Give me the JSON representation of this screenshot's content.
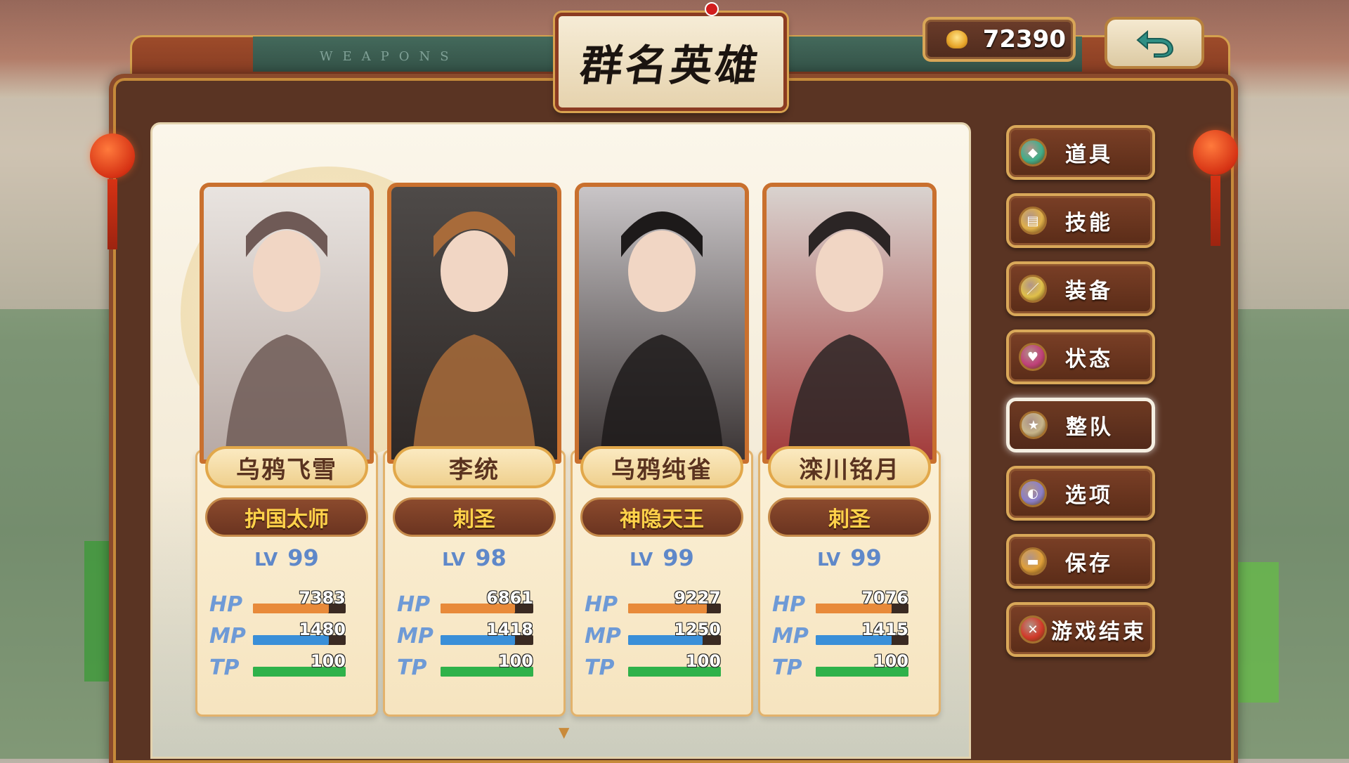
{
  "header": {
    "watermark": "WEAPONS",
    "title": "群名英雄",
    "gold_value": "72390",
    "gold_icon": "gold-ingot-icon",
    "back_icon": "return-arrow-icon"
  },
  "party": [
    {
      "name": "乌鸦飞雪",
      "title": "护国太师",
      "lv_label": "LV",
      "level": "99",
      "hp_label": "HP",
      "hp": "7383",
      "hp_fill": 0.82,
      "mp_label": "MP",
      "mp": "1480",
      "mp_fill": 0.82,
      "tp_label": "TP",
      "tp": "100",
      "tp_fill": 1.0
    },
    {
      "name": "李统",
      "title": "刺圣",
      "lv_label": "LV",
      "level": "98",
      "hp_label": "HP",
      "hp": "6861",
      "hp_fill": 0.8,
      "mp_label": "MP",
      "mp": "1418",
      "mp_fill": 0.8,
      "tp_label": "TP",
      "tp": "100",
      "tp_fill": 1.0
    },
    {
      "name": "乌鸦纯雀",
      "title": "神隐天王",
      "lv_label": "LV",
      "level": "99",
      "hp_label": "HP",
      "hp": "9227",
      "hp_fill": 0.85,
      "mp_label": "MP",
      "mp": "1250",
      "mp_fill": 0.8,
      "tp_label": "TP",
      "tp": "100",
      "tp_fill": 1.0
    },
    {
      "name": "滦川铭月",
      "title": "刺圣",
      "lv_label": "LV",
      "level": "99",
      "hp_label": "HP",
      "hp": "7076",
      "hp_fill": 0.82,
      "mp_label": "MP",
      "mp": "1415",
      "mp_fill": 0.82,
      "tp_label": "TP",
      "tp": "100",
      "tp_fill": 1.0
    }
  ],
  "menu": [
    {
      "label": "道具",
      "icon": "gem-icon",
      "color": "#3fae8a"
    },
    {
      "label": "技能",
      "icon": "scroll-icon",
      "color": "#e0b04a"
    },
    {
      "label": "装备",
      "icon": "sword-icon",
      "color": "#e0c04a"
    },
    {
      "label": "状态",
      "icon": "heart-icon",
      "color": "#c0407a"
    },
    {
      "label": "整队",
      "icon": "star-icon",
      "color": "#c7b58a",
      "active": true
    },
    {
      "label": "选项",
      "icon": "moon-icon",
      "color": "#8a7fc9"
    },
    {
      "label": "保存",
      "icon": "save-icon",
      "color": "#e0a03a"
    },
    {
      "label": "游戏结束",
      "icon": "close-icon",
      "color": "#d23a2a"
    }
  ],
  "colors": {
    "hp_bar": "#e88a3a",
    "mp_bar": "#3a8fd8",
    "tp_bar": "#2fb24a",
    "accent_gold": "#ffd24a"
  }
}
